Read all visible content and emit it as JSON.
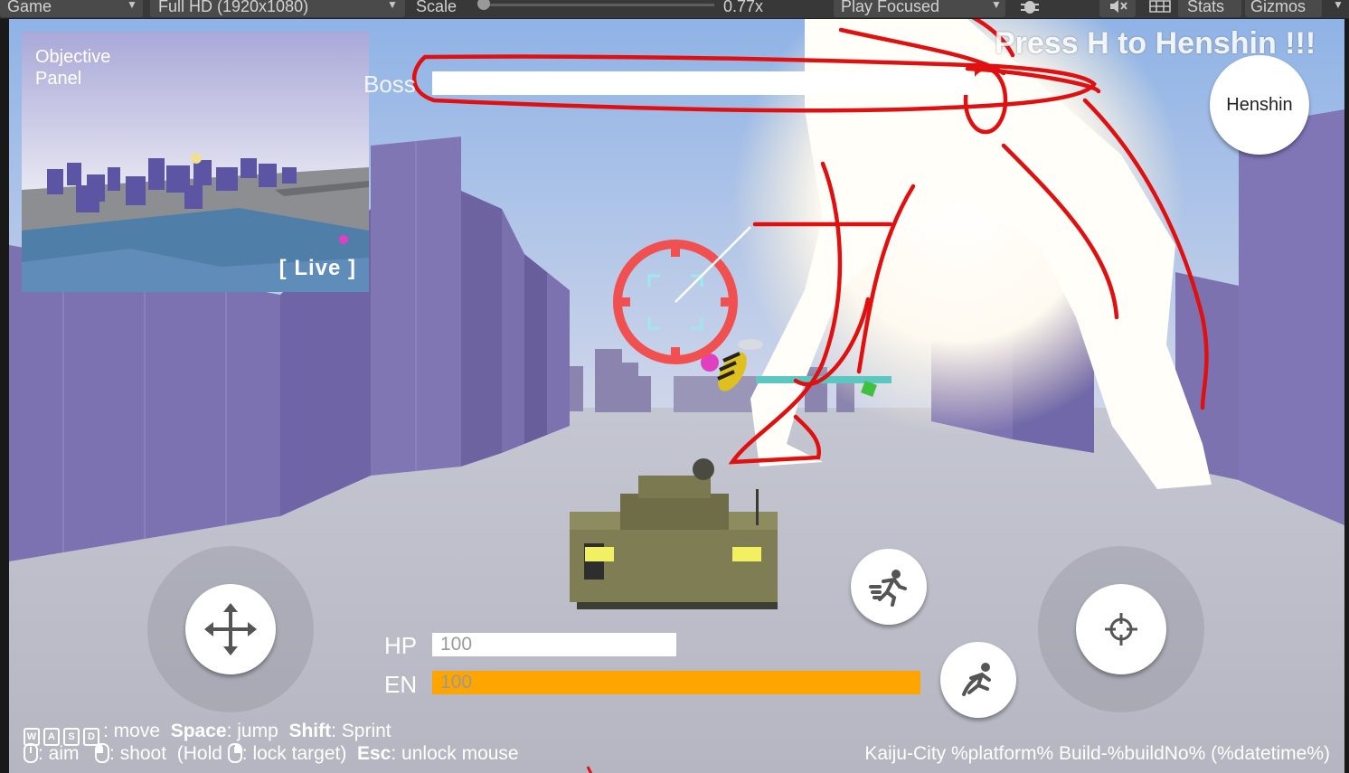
{
  "editor_toolbar": {
    "view": "Game",
    "resolution": "Full HD (1920x1080)",
    "scale_label": "Scale",
    "scale_value": "0.77x",
    "play_mode": "Play Focused",
    "stats": "Stats",
    "gizmos": "Gizmos"
  },
  "minimap": {
    "title": "Objective\nPanel",
    "live": "[ Live ]"
  },
  "boss": {
    "label": "Boss",
    "health": 1.0
  },
  "henshin": {
    "hint": "Press H to Henshin !!!",
    "button": "Henshin"
  },
  "stats": {
    "hp_label": "HP",
    "hp_value": "100",
    "en_label": "EN",
    "en_value": "100",
    "en_color": "#ffa500"
  },
  "controls": {
    "line1": [
      {
        "keys": [
          "W",
          "A",
          "S",
          "D"
        ],
        "bold": "",
        "text": ": move"
      },
      {
        "bold": "Space",
        "text": ": jump"
      },
      {
        "bold": "Shift",
        "text": ": Sprint"
      }
    ],
    "aim": ": aim",
    "shoot": ": shoot",
    "hold_open": "(Hold",
    "lock": ": lock target)",
    "esc_bold": "Esc",
    "esc": ": unlock mouse"
  },
  "build_info": "Kaiju-City %platform% Build-%buildNo% (%datetime%)",
  "icons": [
    "move-arrows-icon",
    "sprint-icon",
    "dodge-icon",
    "crosshair-icon",
    "bug-icon",
    "audio-mute-icon",
    "grid-icon"
  ],
  "colors": {
    "annotation": "#e01010",
    "lock_reticle": "#f05050",
    "boss_bar": "#ffffff"
  }
}
